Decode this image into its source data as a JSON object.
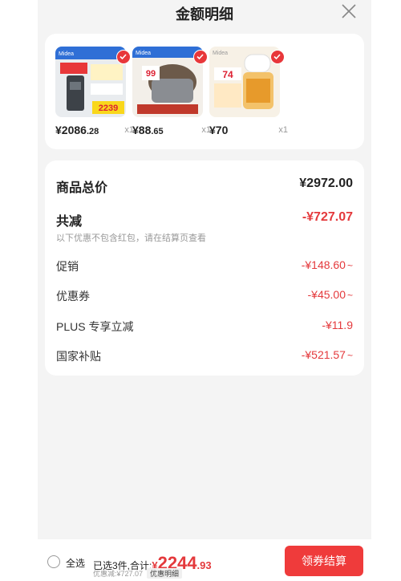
{
  "header": {
    "title": "金额明细",
    "close_icon": "close-icon"
  },
  "products": [
    {
      "price_int": "¥2086",
      "price_dec": ".28",
      "qty": "x1",
      "brand": "Midea",
      "sticker": "2239",
      "icon": "product-thumbnail"
    },
    {
      "price_int": "¥88",
      "price_dec": ".65",
      "qty": "x1",
      "brand": "Midea",
      "sticker": "99",
      "icon": "product-thumbnail"
    },
    {
      "price_int": "¥70",
      "price_dec": "",
      "qty": "x1",
      "brand": "Midea",
      "sticker": "74",
      "icon": "product-thumbnail"
    }
  ],
  "summary": {
    "total_label": "商品总价",
    "total_value": "¥2972.00",
    "reduce_label": "共减",
    "reduce_value": "-¥727.07",
    "note": "以下优惠不包含红包，请在结算页查看",
    "items": [
      {
        "label": "促销",
        "value": "-¥148.60",
        "chevron": "~"
      },
      {
        "label": "优惠券",
        "value": "-¥45.00",
        "chevron": "~"
      },
      {
        "label": "PLUS 专享立减",
        "value": "-¥11.9",
        "chevron": ""
      },
      {
        "label": "国家补贴",
        "value": "-¥521.57",
        "chevron": "~"
      }
    ]
  },
  "bottom": {
    "select_all": "全选",
    "selected_text": "已选3件,合计:",
    "currency": "¥",
    "amount_int": "2244",
    "amount_dec": ".93",
    "discount_text": "优惠减:¥727.07",
    "detail_tag": "优惠明细",
    "checkout_label": "领券结算"
  },
  "colors": {
    "accent": "#e4393c",
    "button": "#ef3b3b",
    "background": "#f4f4f4"
  }
}
